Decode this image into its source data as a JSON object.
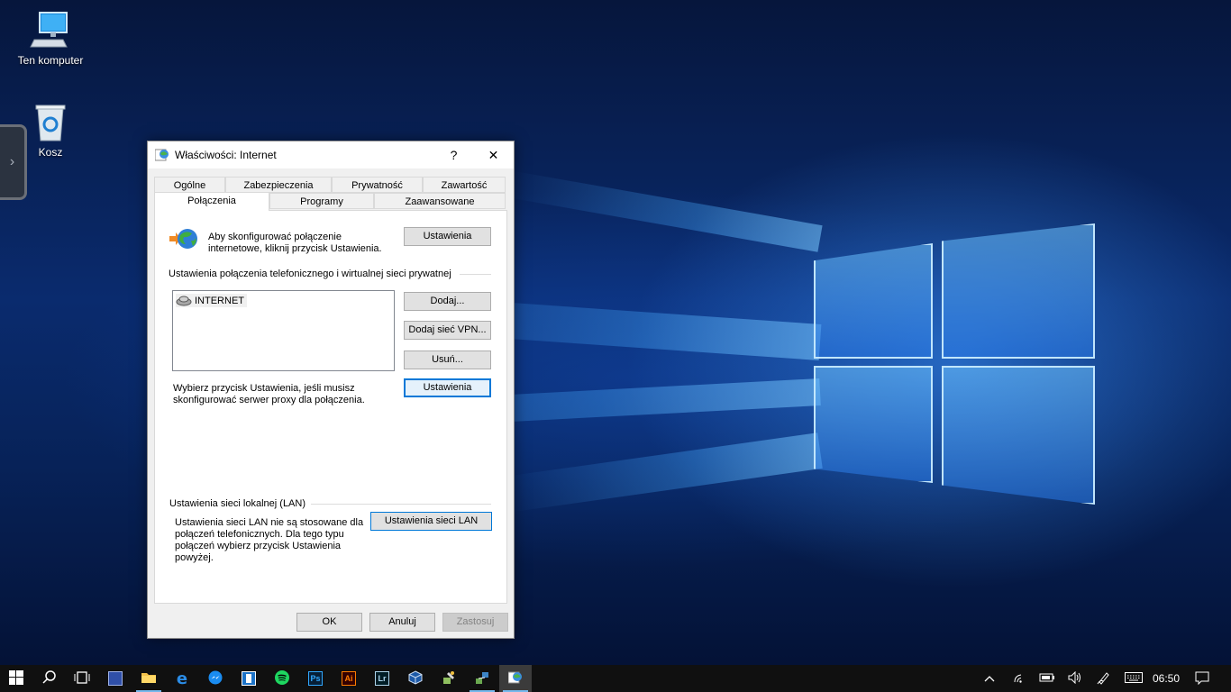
{
  "desktop": {
    "icons": [
      {
        "label": "Ten komputer",
        "icon": "computer-icon"
      },
      {
        "label": "Kosz",
        "icon": "recycle-bin-icon"
      }
    ]
  },
  "dialog": {
    "title": "Właściwości: Internet",
    "help_glyph": "?",
    "close_glyph": "✕",
    "tabs_row1": [
      "Ogólne",
      "Zabezpieczenia",
      "Prywatność",
      "Zawartość"
    ],
    "tabs_row2": [
      "Połączenia",
      "Programy",
      "Zaawansowane"
    ],
    "active_tab": "Połączenia",
    "setup": {
      "text": "Aby skonfigurować połączenie internetowe, kliknij przycisk Ustawienia.",
      "button": "Ustawienia"
    },
    "dialup": {
      "heading": "Ustawienia połączenia telefonicznego i wirtualnej sieci prywatnej",
      "list": [
        "INTERNET"
      ],
      "add_button": "Dodaj...",
      "add_vpn_button": "Dodaj sieć VPN...",
      "remove_button": "Usuń...",
      "proxy_text": "Wybierz przycisk Ustawienia, jeśli musisz skonfigurować serwer proxy dla połączenia.",
      "settings_button": "Ustawienia"
    },
    "lan": {
      "heading": "Ustawienia sieci lokalnej (LAN)",
      "text": "Ustawienia sieci LAN nie są stosowane dla połączeń telefonicznych. Dla tego typu połączeń wybierz przycisk Ustawienia powyżej.",
      "button": "Ustawienia sieci LAN"
    },
    "footer": {
      "ok": "OK",
      "cancel": "Anuluj",
      "apply": "Zastosuj"
    }
  },
  "taskbar": {
    "apps": [
      "start",
      "search",
      "task-view",
      "save",
      "file-explorer",
      "edge",
      "messenger",
      "app",
      "spotify",
      "photoshop",
      "illustrator",
      "lightroom",
      "virtualbox",
      "tool",
      "network-tool",
      "internet-properties"
    ],
    "ps_label": "Ps",
    "ai_label": "Ai",
    "lr_label": "Lr",
    "clock": "06:50",
    "accent": "#0078d7"
  }
}
